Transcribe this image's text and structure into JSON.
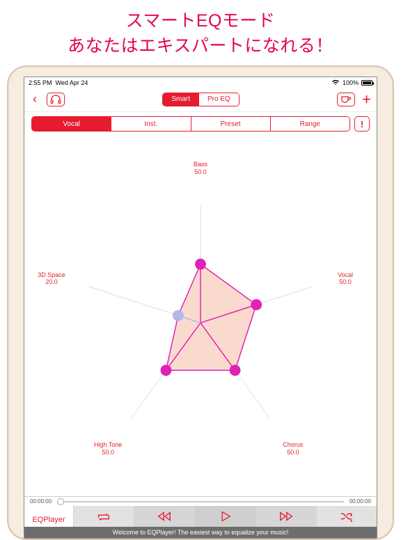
{
  "hero": {
    "line1": "スマートEQモード",
    "line2": "あなたはエキスパートになれる！"
  },
  "status": {
    "time": "2:55 PM",
    "date": "Wed Apr 24",
    "battery_pct": "100%"
  },
  "topbar": {
    "modes": [
      {
        "label": "Smart",
        "active": true
      },
      {
        "label": "Pro EQ",
        "active": false
      }
    ]
  },
  "tabs": {
    "items": [
      {
        "label": "Vocal",
        "active": true
      },
      {
        "label": "Inst.",
        "active": false
      },
      {
        "label": "Preset",
        "active": false
      },
      {
        "label": "Range",
        "active": false
      }
    ]
  },
  "chart_data": {
    "type": "radar",
    "axes": [
      {
        "name": "Bass",
        "value": 50.0
      },
      {
        "name": "Vocal",
        "value": 50.0
      },
      {
        "name": "Chorus",
        "value": 50.0
      },
      {
        "name": "High Tone",
        "value": 50.0
      },
      {
        "name": "3D Space",
        "value": 20.0
      }
    ],
    "range": [
      0,
      100
    ]
  },
  "playback": {
    "current": "00:00:00",
    "total": "00:00:00"
  },
  "brand": "EQPlayer",
  "ticker": "Welcome to EQPlayer! The easiest way to equalize your music!"
}
